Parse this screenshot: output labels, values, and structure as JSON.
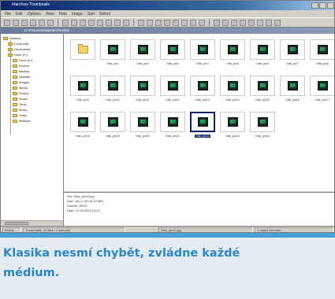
{
  "window": {
    "title": "IrfanView Thumbnails",
    "menu": [
      "File",
      "Edit",
      "Options",
      "View",
      "Help",
      "Image",
      "Sort",
      "Select"
    ],
    "address": "D:\\Pictures\\Diskette\\Thumbs"
  },
  "tree": {
    "items": [
      "Desktop",
      "Local Disk",
      "Documents",
      "Drive (C:)",
      "Drive (D:)",
      "Archive",
      "Backup",
      "Diskette",
      "Images",
      "Media",
      "Photos",
      "Scans",
      "Temp",
      "Music",
      "Video",
      "Network"
    ]
  },
  "thumbnails": [
    {
      "kind": "folder",
      "label": ".."
    },
    {
      "kind": "chip",
      "label": "Disk_pic1"
    },
    {
      "kind": "chip",
      "label": "Disk_pic2"
    },
    {
      "kind": "chip",
      "label": "Disk_pic3"
    },
    {
      "kind": "chip",
      "label": "Disk_pic4"
    },
    {
      "kind": "chip",
      "label": "Disk_pic5"
    },
    {
      "kind": "chip",
      "label": "Disk_pic6"
    },
    {
      "kind": "chip",
      "label": "Disk_pic7"
    },
    {
      "kind": "chip",
      "label": "Disk_pic8"
    },
    {
      "kind": "chip",
      "label": "Disk_pic9"
    },
    {
      "kind": "chip",
      "label": "Disk_pic10"
    },
    {
      "kind": "chip",
      "label": "Disk_pic11"
    },
    {
      "kind": "chip",
      "label": "Disk_pic12"
    },
    {
      "kind": "chip",
      "label": "Disk_pic13"
    },
    {
      "kind": "chip",
      "label": "Disk_pic14"
    },
    {
      "kind": "chip",
      "label": "Disk_pic15"
    },
    {
      "kind": "chip",
      "label": "Disk_pic16"
    },
    {
      "kind": "chip",
      "label": "Disk_pic17"
    },
    {
      "kind": "chip",
      "label": "Disk_pic18"
    },
    {
      "kind": "chip",
      "label": "Disk_pic19"
    },
    {
      "kind": "chip",
      "label": "Disk_pic20"
    },
    {
      "kind": "chip",
      "label": "Disk_pic21"
    },
    {
      "kind": "chip",
      "label": "Disk_pic22",
      "selected": true
    },
    {
      "kind": "chip",
      "label": "Disk_pic23"
    },
    {
      "kind": "chip",
      "label": "Disk_pic24"
    }
  ],
  "info": {
    "lines": [
      "File: Disk_pic22.jpg",
      "Size: 160 x 120 (0.02 MP)",
      "Format: JPEG",
      "Date: 12.05.2003 14:22"
    ]
  },
  "status": {
    "cells": [
      "Ready",
      "Thumbnails: 24 files / 1 selected",
      "Disk_pic22.jpg",
      "1 object selected"
    ]
  },
  "caption": "Klasika nesmí chybět, zvládne každé médium.",
  "colors": {
    "caption_text": "#2a86c8",
    "caption_bar": "#4a9fd6",
    "caption_bg": "#e4ecf2",
    "selection": "#0a246a"
  }
}
